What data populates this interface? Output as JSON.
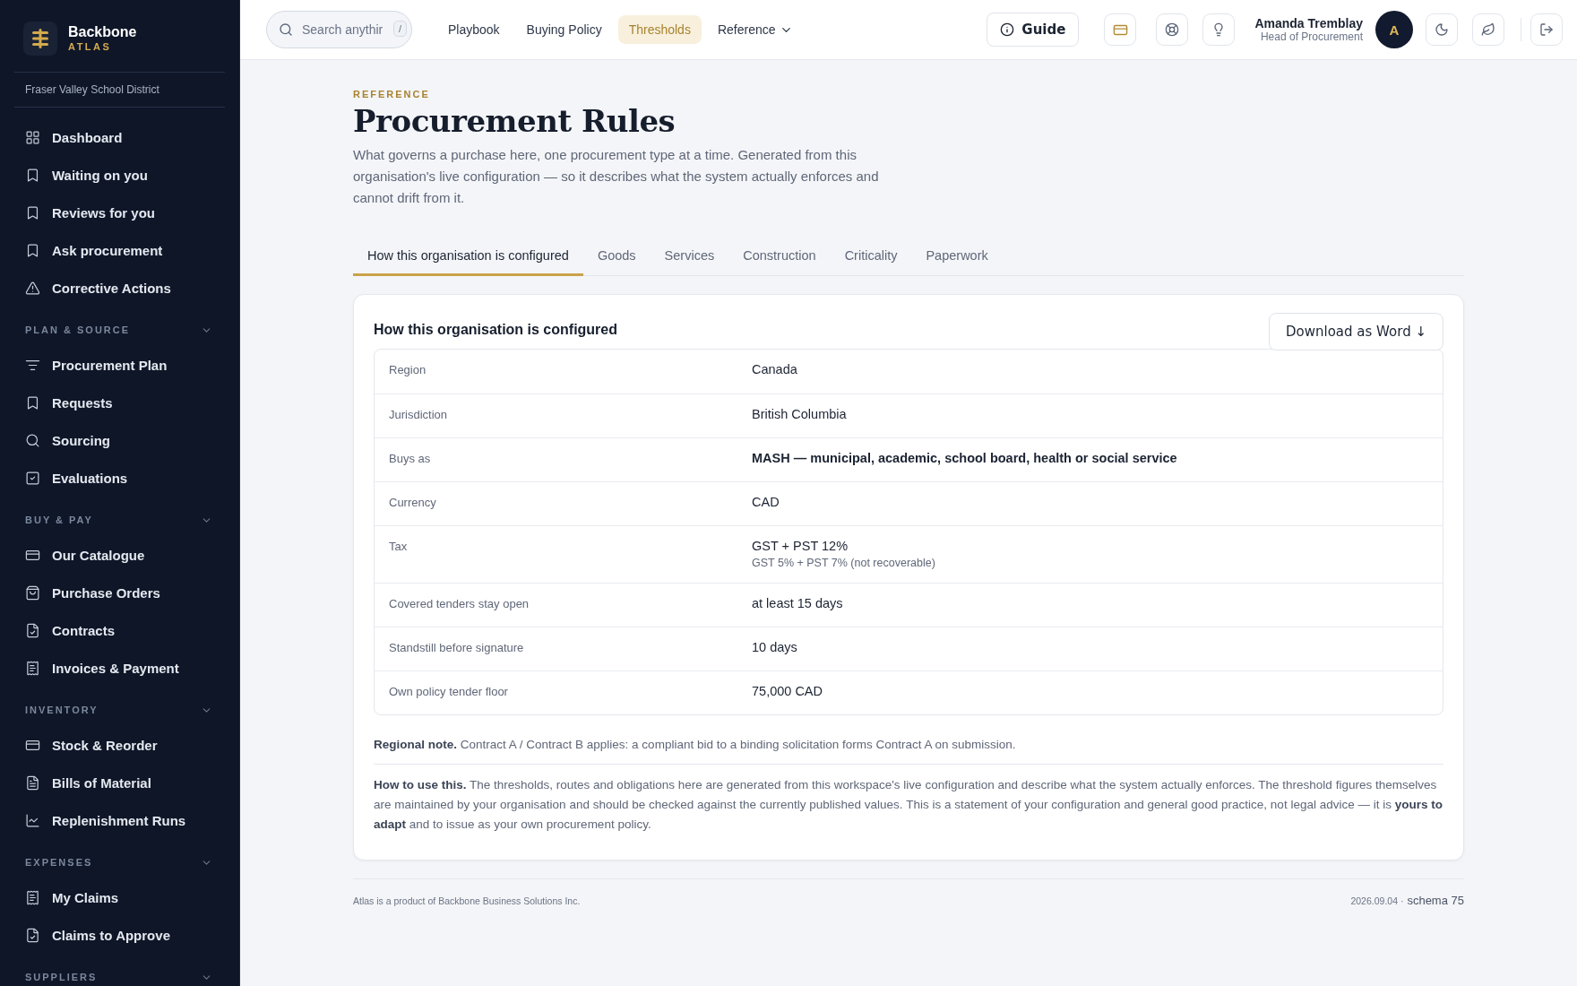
{
  "brand": {
    "name": "Backbone",
    "sub": "ATLAS"
  },
  "organisation": "Fraser Valley School District",
  "sidebar": {
    "top_items": [
      {
        "label": "Dashboard"
      },
      {
        "label": "Waiting on you"
      },
      {
        "label": "Reviews for you"
      },
      {
        "label": "Ask procurement"
      },
      {
        "label": "Corrective Actions"
      }
    ],
    "sections": [
      {
        "title": "PLAN & SOURCE",
        "expanded": true,
        "items": [
          {
            "label": "Procurement Plan"
          },
          {
            "label": "Requests"
          },
          {
            "label": "Sourcing"
          },
          {
            "label": "Evaluations"
          }
        ]
      },
      {
        "title": "BUY & PAY",
        "expanded": true,
        "items": [
          {
            "label": "Our Catalogue"
          },
          {
            "label": "Purchase Orders"
          },
          {
            "label": "Contracts"
          },
          {
            "label": "Invoices & Payment"
          }
        ]
      },
      {
        "title": "INVENTORY",
        "expanded": true,
        "items": [
          {
            "label": "Stock & Reorder"
          },
          {
            "label": "Bills of Material"
          },
          {
            "label": "Replenishment Runs"
          }
        ]
      },
      {
        "title": "EXPENSES",
        "expanded": true,
        "items": [
          {
            "label": "My Claims"
          },
          {
            "label": "Claims to Approve"
          }
        ]
      },
      {
        "title": "SUPPLIERS",
        "expanded": true
      }
    ]
  },
  "topbar": {
    "search": {
      "placeholder": "Search anythir",
      "shortcut": "/"
    },
    "nav": [
      {
        "label": "Playbook",
        "selected": false
      },
      {
        "label": "Buying Policy",
        "selected": false
      },
      {
        "label": "Thresholds",
        "selected": true
      },
      {
        "label": "Reference",
        "selected": false,
        "dropdown": true
      }
    ],
    "guide": "Guide",
    "user": {
      "name": "Amanda Tremblay",
      "role": "Head of Procurement",
      "initial": "A"
    }
  },
  "page": {
    "eyebrow": "REFERENCE",
    "title": "Procurement Rules",
    "description": "What governs a purchase here, one procurement type at a time. Generated from this organisation's live configuration — so it describes what the system actually enforces and cannot drift from it.",
    "tabs": [
      {
        "label": "How this organisation is configured",
        "selected": true
      },
      {
        "label": "Goods",
        "selected": false
      },
      {
        "label": "Services",
        "selected": false
      },
      {
        "label": "Construction",
        "selected": false
      },
      {
        "label": "Criticality",
        "selected": false
      },
      {
        "label": "Paperwork",
        "selected": false
      }
    ],
    "card": {
      "title": "How this organisation is configured",
      "download": "Download as Word ↓",
      "rows": [
        {
          "label": "Region",
          "value": "Canada",
          "strong": false
        },
        {
          "label": "Jurisdiction",
          "value": "British Columbia",
          "strong": false
        },
        {
          "label": "Buys as",
          "value": "MASH — municipal, academic, school board, health or social service",
          "strong": true
        },
        {
          "label": "Currency",
          "value": "CAD",
          "strong": false
        },
        {
          "label": "Tax",
          "value": "GST + PST 12%",
          "sub": "GST 5% + PST 7% (not recoverable)",
          "strong": false
        },
        {
          "label": "Covered tenders stay open",
          "value": "at least 15 days",
          "strong": false
        },
        {
          "label": "Standstill before signature",
          "value": "10 days",
          "strong": false
        },
        {
          "label": "Own policy tender floor",
          "value": "75,000 CAD",
          "strong": false
        }
      ],
      "regional_note": "**Regional note.** Contract A / Contract B applies: a compliant bid to a binding solicitation forms Contract A on submission.",
      "how_to_use": "**How to use this.** The thresholds, routes and obligations here are generated from this workspace's live configuration and describe what the system actually enforces. The threshold figures themselves are maintained by your organisation and should be checked against the currently published values. This is a statement of your configuration and general good practice, not legal advice — it is **yours to adapt** and to issue as your own procurement policy."
    }
  },
  "footer": {
    "left": "Atlas is a product of Backbone Business Solutions Inc.",
    "version": "2026.09.04 ·",
    "schema": "schema 75"
  }
}
